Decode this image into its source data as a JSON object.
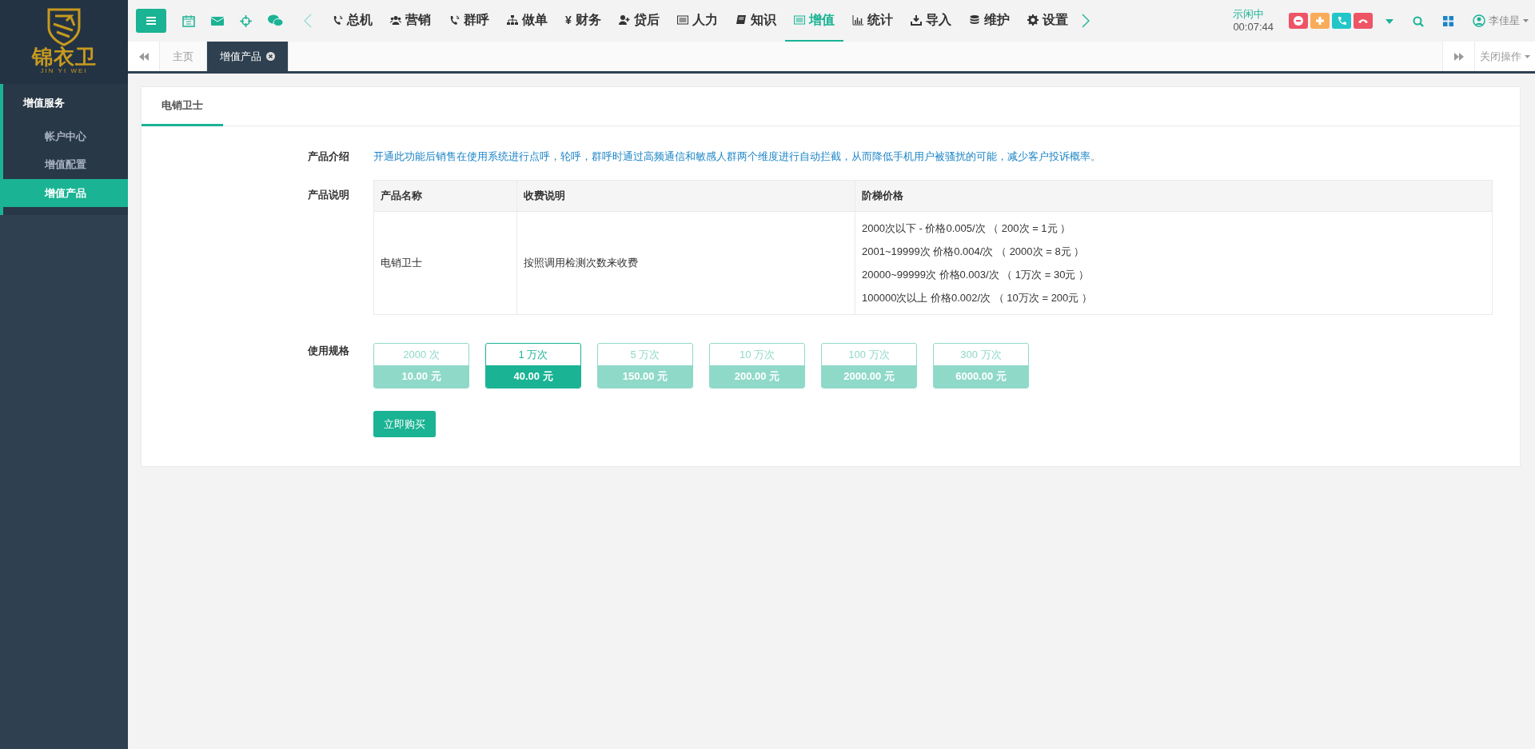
{
  "sidebar": {
    "logo": {
      "title": "锦衣卫",
      "subtitle": "JIN YI WEI"
    },
    "section": "增值服务",
    "items": [
      {
        "label": "帐户中心",
        "selected": false
      },
      {
        "label": "增值配置",
        "selected": false
      },
      {
        "label": "增值产品",
        "selected": true
      }
    ]
  },
  "toolbar": {
    "nav": [
      {
        "label": "总机",
        "selected": false
      },
      {
        "label": "营销",
        "selected": false
      },
      {
        "label": "群呼",
        "selected": false
      },
      {
        "label": "做单",
        "selected": false
      },
      {
        "label": "财务",
        "glyph": "¥",
        "selected": false
      },
      {
        "label": "贷后",
        "selected": false
      },
      {
        "label": "人力",
        "selected": false
      },
      {
        "label": "知识",
        "selected": false
      },
      {
        "label": "增值",
        "selected": true
      },
      {
        "label": "统计",
        "selected": false
      },
      {
        "label": "导入",
        "selected": false
      },
      {
        "label": "维护",
        "selected": false
      },
      {
        "label": "设置",
        "selected": false
      }
    ],
    "status": {
      "label": "示闲中",
      "timer": "00:07:44"
    },
    "user": "李佳星"
  },
  "page_tabs": [
    {
      "label": "主页",
      "selected": false,
      "closable": false
    },
    {
      "label": "增值产品",
      "selected": true,
      "closable": true
    }
  ],
  "close_menu": "关闭操作",
  "panel": {
    "tabs": [
      {
        "label": "电销卫士",
        "selected": true
      }
    ],
    "intro_label": "产品介绍",
    "intro": "开通此功能后销售在使用系统进行点呼，轮呼，群呼时通过高频通信和敏感人群两个维度进行自动拦截，从而降低手机用户被骚扰的可能，减少客户投诉概率。",
    "desc_label": "产品说明",
    "table": {
      "columns": [
        "产品名称",
        "收费说明",
        "阶梯价格"
      ],
      "rows": [
        {
          "name": "电销卫士",
          "billing": "按照调用检测次数来收费",
          "tiers": [
            "2000次以下 - 价格0.005/次 （ 200次 = 1元 ）",
            "2001~19999次 价格0.004/次 （ 2000次 = 8元 ）",
            "20000~99999次 价格0.003/次 （ 1万次 = 30元 ）",
            "100000次以上 价格0.002/次 （ 10万次 = 200元 ）"
          ]
        }
      ]
    },
    "spec_label": "使用规格",
    "specs": [
      {
        "quantity": "2000 次",
        "price": "10.00 元",
        "selected": false
      },
      {
        "quantity": "1 万次",
        "price": "40.00 元",
        "selected": true
      },
      {
        "quantity": "5 万次",
        "price": "150.00 元",
        "selected": false
      },
      {
        "quantity": "10 万次",
        "price": "200.00 元",
        "selected": false
      },
      {
        "quantity": "100 万次",
        "price": "2000.00 元",
        "selected": false
      },
      {
        "quantity": "300 万次",
        "price": "6000.00 元",
        "selected": false
      }
    ],
    "buy_button": "立即购买"
  }
}
